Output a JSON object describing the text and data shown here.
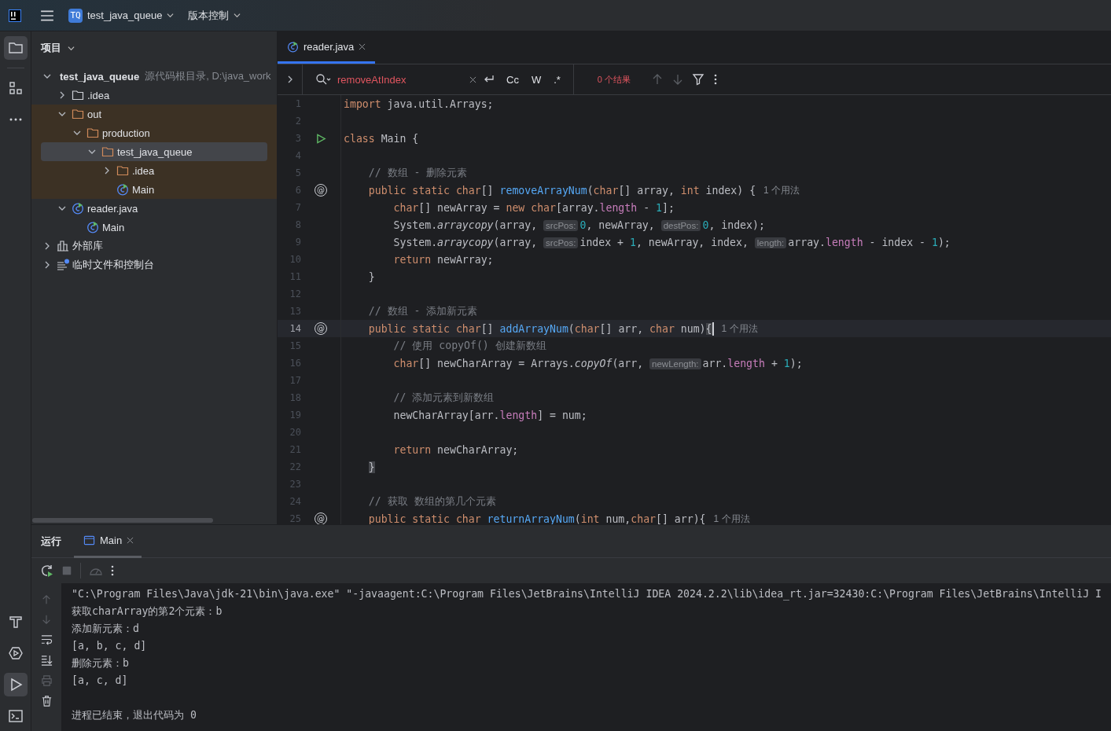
{
  "top_bar": {
    "project_badge": "TQ",
    "project_name": "test_java_queue",
    "vcs_label": "版本控制"
  },
  "left_strip": {
    "top": [
      {
        "kind": "project",
        "selected": true
      },
      {
        "kind": "structure",
        "selected": false
      },
      {
        "kind": "more",
        "selected": false
      }
    ],
    "bottom": [
      {
        "kind": "build",
        "selected": false
      },
      {
        "kind": "services",
        "selected": false
      },
      {
        "kind": "run",
        "selected": true
      },
      {
        "kind": "terminal",
        "selected": false
      }
    ]
  },
  "project": {
    "title": "项目",
    "tree": [
      {
        "label": "test_java_queue",
        "hint": "源代码根目录, D:\\java_work",
        "kind": "module",
        "expanded": true,
        "selected": false,
        "excluded": false,
        "children": [
          {
            "label": ".idea",
            "kind": "folder",
            "expanded": false,
            "selected": false,
            "excluded": false
          },
          {
            "label": "out",
            "kind": "folder",
            "expanded": true,
            "selected": false,
            "excluded": true,
            "children": [
              {
                "label": "production",
                "kind": "folder",
                "expanded": true,
                "selected": false,
                "excluded": true,
                "children": [
                  {
                    "label": "test_java_queue",
                    "kind": "folder",
                    "expanded": true,
                    "selected": true,
                    "excluded": true,
                    "children": [
                      {
                        "label": ".idea",
                        "kind": "folder",
                        "expanded": false,
                        "selected": false,
                        "excluded": true
                      },
                      {
                        "label": "Main",
                        "kind": "class",
                        "selected": false,
                        "excluded": true
                      }
                    ]
                  }
                ]
              }
            ]
          },
          {
            "label": "reader.java",
            "kind": "class",
            "expanded": true,
            "selected": false,
            "excluded": false,
            "children": [
              {
                "label": "Main",
                "kind": "class",
                "selected": false,
                "excluded": false
              }
            ]
          }
        ]
      },
      {
        "label": "外部库",
        "kind": "library",
        "expanded": false,
        "selected": false,
        "excluded": false
      },
      {
        "label": "临时文件和控制台",
        "kind": "scratches",
        "expanded": false,
        "selected": false,
        "excluded": false
      }
    ]
  },
  "editor": {
    "tabs": [
      {
        "label": "reader.java",
        "selected": true
      }
    ],
    "search": {
      "value": "removeAtIndex",
      "no_match": true,
      "options": [
        {
          "label": "Cc",
          "selected": false
        },
        {
          "label": "W",
          "selected": false
        },
        {
          "label": ".*",
          "selected": false
        }
      ],
      "result": "0 个结果"
    },
    "lines": [
      {
        "num": "1",
        "current": false,
        "tokens": [
          {
            "kind": "keyword",
            "t": "import"
          },
          {
            "kind": "plain",
            "t": " java.util.Arrays;"
          }
        ]
      },
      {
        "num": "2",
        "current": false
      },
      {
        "num": "3",
        "current": false,
        "gutter": {
          "kind": "run"
        },
        "tokens": [
          {
            "kind": "keyword",
            "t": "class"
          },
          {
            "kind": "plain",
            "t": " Main {"
          }
        ]
      },
      {
        "num": "4",
        "current": false
      },
      {
        "num": "5",
        "current": false,
        "tokens": [
          {
            "kind": "comment",
            "t": "    // 数组 - 删除元素"
          }
        ]
      },
      {
        "num": "6",
        "current": false,
        "gutter": {
          "kind": "symbol",
          "text": "@"
        },
        "usage": "1 个用法",
        "tokens": [
          {
            "kind": "keyword",
            "t": "    public static char"
          },
          {
            "kind": "plain",
            "t": "[] "
          },
          {
            "kind": "function",
            "t": "removeArrayNum"
          },
          {
            "kind": "plain",
            "t": "("
          },
          {
            "kind": "keyword",
            "t": "char"
          },
          {
            "kind": "plain",
            "t": "[] array, "
          },
          {
            "kind": "keyword",
            "t": "int"
          },
          {
            "kind": "plain",
            "t": " index) {"
          }
        ]
      },
      {
        "num": "7",
        "current": false,
        "tokens": [
          {
            "kind": "keyword",
            "t": "        char"
          },
          {
            "kind": "plain",
            "t": "[] newArray = "
          },
          {
            "kind": "keyword",
            "t": "new char"
          },
          {
            "kind": "plain",
            "t": "[array."
          },
          {
            "kind": "field",
            "t": "length"
          },
          {
            "kind": "plain",
            "t": " - "
          },
          {
            "kind": "number",
            "t": "1"
          },
          {
            "kind": "plain",
            "t": "];"
          }
        ]
      },
      {
        "num": "8",
        "current": false,
        "tokens": [
          {
            "kind": "plain",
            "t": "        System."
          },
          {
            "kind": "static_call",
            "t": "arraycopy"
          },
          {
            "kind": "plain",
            "t": "(array, "
          },
          {
            "kind": "param_hint",
            "t": "srcPos:"
          },
          {
            "kind": "number",
            "t": "0"
          },
          {
            "kind": "plain",
            "t": ", newArray, "
          },
          {
            "kind": "param_hint",
            "t": "destPos:"
          },
          {
            "kind": "number",
            "t": "0"
          },
          {
            "kind": "plain",
            "t": ", index);"
          }
        ]
      },
      {
        "num": "9",
        "current": false,
        "tokens": [
          {
            "kind": "plain",
            "t": "        System."
          },
          {
            "kind": "static_call",
            "t": "arraycopy"
          },
          {
            "kind": "plain",
            "t": "(array, "
          },
          {
            "kind": "param_hint",
            "t": "srcPos:"
          },
          {
            "kind": "plain",
            "t": "index + "
          },
          {
            "kind": "number",
            "t": "1"
          },
          {
            "kind": "plain",
            "t": ", newArray, index, "
          },
          {
            "kind": "param_hint",
            "t": "length:"
          },
          {
            "kind": "plain",
            "t": "array."
          },
          {
            "kind": "field",
            "t": "length"
          },
          {
            "kind": "plain",
            "t": " - index - "
          },
          {
            "kind": "number",
            "t": "1"
          },
          {
            "kind": "plain",
            "t": ");"
          }
        ]
      },
      {
        "num": "10",
        "current": false,
        "tokens": [
          {
            "kind": "keyword",
            "t": "        return"
          },
          {
            "kind": "plain",
            "t": " newArray;"
          }
        ]
      },
      {
        "num": "11",
        "current": false,
        "tokens": [
          {
            "kind": "plain",
            "t": "    }"
          }
        ]
      },
      {
        "num": "12",
        "current": false
      },
      {
        "num": "13",
        "current": false,
        "tokens": [
          {
            "kind": "comment",
            "t": "    // 数组 - 添加新元素"
          }
        ]
      },
      {
        "num": "14",
        "current": true,
        "gutter": {
          "kind": "symbol",
          "text": "@"
        },
        "usage": "1 个用法",
        "tokens": [
          {
            "kind": "keyword",
            "t": "    public static char"
          },
          {
            "kind": "plain",
            "t": "[] "
          },
          {
            "kind": "function",
            "t": "addArrayNum"
          },
          {
            "kind": "plain",
            "t": "("
          },
          {
            "kind": "keyword",
            "t": "char"
          },
          {
            "kind": "plain",
            "t": "[] arr, "
          },
          {
            "kind": "keyword",
            "t": "char"
          },
          {
            "kind": "plain",
            "t": " num)"
          },
          {
            "kind": "brace_match",
            "t": "{"
          }
        ]
      },
      {
        "num": "15",
        "current": false,
        "tokens": [
          {
            "kind": "comment",
            "t": "        // 使用 copyOf() 创建新数组"
          }
        ]
      },
      {
        "num": "16",
        "current": false,
        "tokens": [
          {
            "kind": "keyword",
            "t": "        char"
          },
          {
            "kind": "plain",
            "t": "[] newCharArray = Arrays."
          },
          {
            "kind": "static_call",
            "t": "copyOf"
          },
          {
            "kind": "plain",
            "t": "(arr, "
          },
          {
            "kind": "param_hint",
            "t": "newLength:"
          },
          {
            "kind": "plain",
            "t": "arr."
          },
          {
            "kind": "field",
            "t": "length"
          },
          {
            "kind": "plain",
            "t": " + "
          },
          {
            "kind": "number",
            "t": "1"
          },
          {
            "kind": "plain",
            "t": ");"
          }
        ]
      },
      {
        "num": "17",
        "current": false
      },
      {
        "num": "18",
        "current": false,
        "tokens": [
          {
            "kind": "comment",
            "t": "        // 添加元素到新数组"
          }
        ]
      },
      {
        "num": "19",
        "current": false,
        "tokens": [
          {
            "kind": "plain",
            "t": "        newCharArray[arr."
          },
          {
            "kind": "field",
            "t": "length"
          },
          {
            "kind": "plain",
            "t": "] = num;"
          }
        ]
      },
      {
        "num": "20",
        "current": false
      },
      {
        "num": "21",
        "current": false,
        "tokens": [
          {
            "kind": "keyword",
            "t": "        return"
          },
          {
            "kind": "plain",
            "t": " newCharArray;"
          }
        ]
      },
      {
        "num": "22",
        "current": false,
        "tokens": [
          {
            "kind": "brace_match",
            "t": "    }"
          }
        ]
      },
      {
        "num": "23",
        "current": false
      },
      {
        "num": "24",
        "current": false,
        "tokens": [
          {
            "kind": "comment",
            "t": "    // 获取 数组的第几个元素"
          }
        ]
      },
      {
        "num": "25",
        "current": false,
        "gutter": {
          "kind": "symbol",
          "text": "@"
        },
        "usage": "1 个用法",
        "tokens": [
          {
            "kind": "keyword",
            "t": "    public static char"
          },
          {
            "kind": "function",
            "t": " returnArrayNum"
          },
          {
            "kind": "plain",
            "t": "("
          },
          {
            "kind": "keyword",
            "t": "int"
          },
          {
            "kind": "plain",
            "t": " num,"
          },
          {
            "kind": "keyword",
            "t": "char"
          },
          {
            "kind": "plain",
            "t": "[] arr){"
          }
        ]
      }
    ]
  },
  "run_panel": {
    "title": "运行",
    "tabs": [
      {
        "label": "Main",
        "selected": true
      }
    ],
    "console": [
      {
        "kind": "command",
        "text": "\"C:\\Program Files\\Java\\jdk-21\\bin\\java.exe\" \"-javaagent:C:\\Program Files\\JetBrains\\IntelliJ IDEA 2024.2.2\\lib\\idea_rt.jar=32430:C:\\Program Files\\JetBrains\\IntelliJ I"
      },
      {
        "kind": "output",
        "text": "获取charArray的第2个元素：b"
      },
      {
        "kind": "output",
        "text": "添加新元素：d"
      },
      {
        "kind": "output",
        "text": "[a, b, c, d]"
      },
      {
        "kind": "output",
        "text": "删除元素：b"
      },
      {
        "kind": "output",
        "text": "[a, c, d]"
      },
      {
        "kind": "status",
        "text": "进程已结束，退出代码为 0"
      }
    ]
  }
}
